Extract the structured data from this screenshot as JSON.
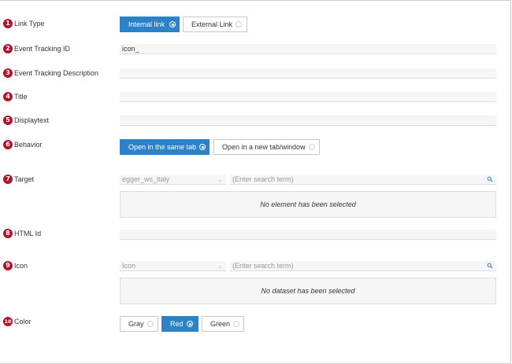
{
  "rows": {
    "link_type": {
      "number": "1",
      "label": "Link Type",
      "options": [
        "Internal link",
        "External Link"
      ],
      "selected": "Internal link"
    },
    "event_tracking_id": {
      "number": "2",
      "label": "Event Tracking ID",
      "value": "icon_"
    },
    "event_tracking_description": {
      "number": "3",
      "label": "Event Tracking Description",
      "value": ""
    },
    "title": {
      "number": "4",
      "label": "Title",
      "value": ""
    },
    "displaytext": {
      "number": "5",
      "label": "Displaytext",
      "value": ""
    },
    "behavior": {
      "number": "6",
      "label": "Behavior",
      "options": [
        "Open in the same tab",
        "Open in a new tab/window"
      ],
      "selected": "Open in the same tab"
    },
    "target": {
      "number": "7",
      "label": "Target",
      "select_value": "egger_ws_italy",
      "search_placeholder": "(Enter search term)",
      "empty_text": "No element has been selected"
    },
    "html_id": {
      "number": "8",
      "label": "HTML Id",
      "value": ""
    },
    "icon": {
      "number": "9",
      "label": "Icon",
      "select_value": "Icon",
      "search_placeholder": "(Enter search term)",
      "empty_text": "No dataset has been selected"
    },
    "color": {
      "number": "10",
      "label": "Color",
      "options": [
        "Gray",
        "Red",
        "Green"
      ],
      "selected": "Red"
    }
  },
  "colors": {
    "accent": "#2b82c9",
    "badge": "#b1142c"
  },
  "icons": {
    "select_chevron": "chevron-down-icon",
    "search": "search-icon"
  }
}
